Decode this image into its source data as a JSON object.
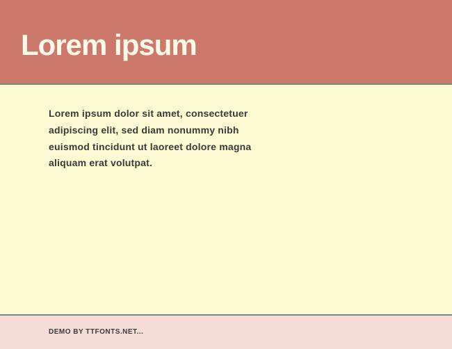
{
  "header": {
    "title": "Lorem ipsum"
  },
  "content": {
    "body": "Lorem ipsum dolor sit amet, consectetuer adipiscing elit, sed diam nonummy nibh euismod tincidunt ut laoreet dolore magna aliquam erat volutpat."
  },
  "footer": {
    "credit": "DEMO BY TTFONTS.NET..."
  }
}
